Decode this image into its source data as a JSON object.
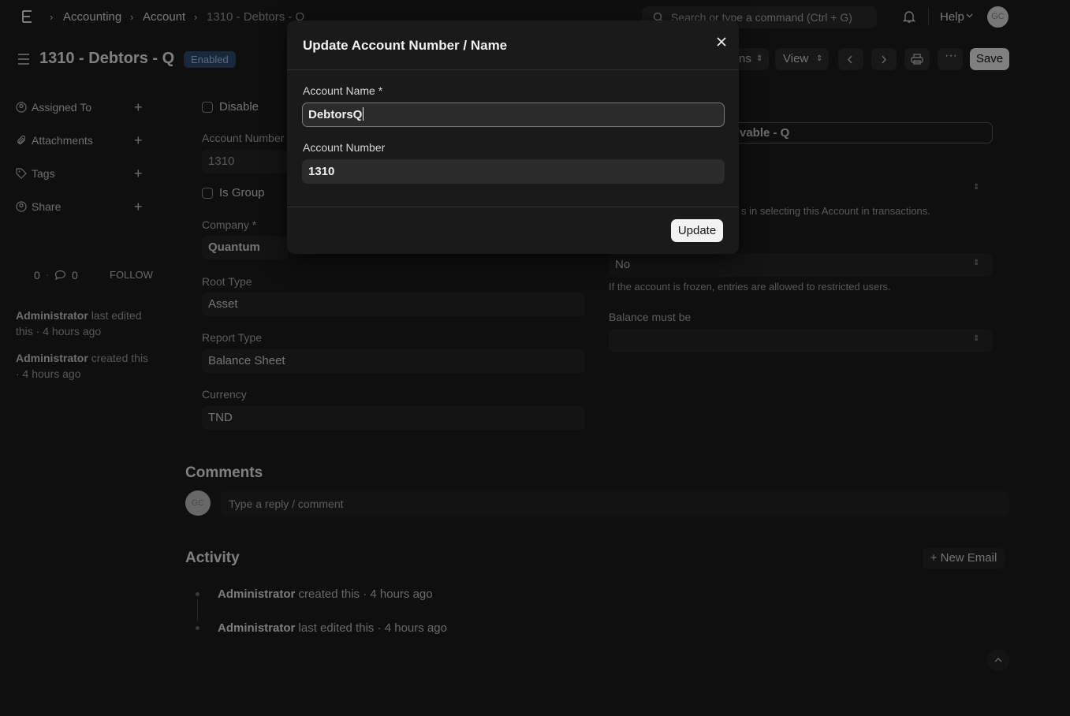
{
  "navbar": {
    "breadcrumbs": [
      "Accounting",
      "Account",
      "1310 - Debtors - Q"
    ],
    "search_placeholder": "Search or type a command (Ctrl + G)",
    "help_label": "Help",
    "avatar_initials": "GC"
  },
  "page": {
    "title": "1310 - Debtors - Q",
    "status_badge": "Enabled",
    "actions_label_fragment": "ns",
    "view_label": "View",
    "save_label": "Save"
  },
  "sidebar": {
    "items": [
      {
        "label": "Assigned To"
      },
      {
        "label": "Attachments"
      },
      {
        "label": "Tags"
      },
      {
        "label": "Share"
      }
    ],
    "likes_count": "0",
    "comments_count": "0",
    "follow_label": "FOLLOW",
    "last_edited_user": "Administrator",
    "last_edited_text": "last edited this · 4 hours ago",
    "created_user": "Administrator",
    "created_text": "created this · 4 hours ago"
  },
  "form": {
    "disable_label": "Disable",
    "account_number_label": "Account Number",
    "account_number_value": "1310",
    "is_group_label": "Is Group",
    "company_label": "Company *",
    "company_value": "Quantum",
    "root_type_label": "Root Type",
    "root_type_value": "Asset",
    "report_type_label": "Report Type",
    "report_type_value": "Balance Sheet",
    "currency_label": "Currency",
    "currency_value": "TND",
    "parent_account_fragment": "vable - Q",
    "account_type_help_fragment": "s in selecting this Account in transactions.",
    "frozen_value": "No",
    "frozen_help": "If the account is frozen, entries are allowed to restricted users.",
    "balance_must_be_label": "Balance must be"
  },
  "comments": {
    "title": "Comments",
    "placeholder": "Type a reply / comment"
  },
  "activity": {
    "title": "Activity",
    "new_email_label": "+ New Email",
    "items": [
      {
        "user": "Administrator",
        "text": "created this · 4 hours ago"
      },
      {
        "user": "Administrator",
        "text": "last edited this · 4 hours ago"
      }
    ]
  },
  "modal": {
    "title": "Update Account Number / Name",
    "account_name_label": "Account Name *",
    "account_name_value": "DebtorsQ",
    "account_number_label": "Account Number",
    "account_number_value": "1310",
    "update_label": "Update"
  }
}
